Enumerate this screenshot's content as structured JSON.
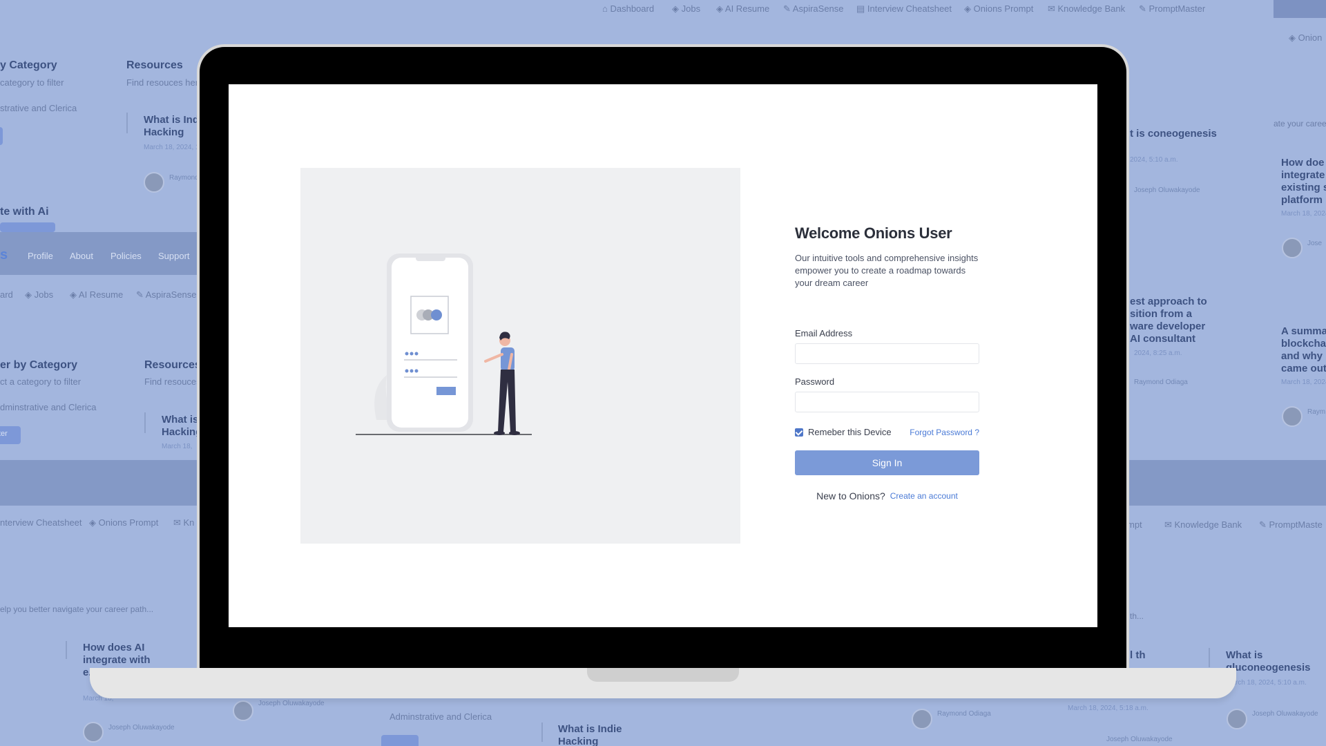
{
  "background": {
    "top_nav": [
      "Dashboard",
      "Jobs",
      "AI Resume",
      "AspiraSense",
      "Interview Cheatsheet",
      "Onions Prompt",
      "Knowledge Bank",
      "PromptMaster"
    ],
    "top_right_text": "Onion",
    "mid_nav": [
      "Profile",
      "About",
      "Policies",
      "Support"
    ],
    "mid_nav_logo": "s",
    "mid_nav2": [
      "ard",
      "Jobs",
      "AI Resume",
      "AspiraSense"
    ],
    "bottom_nav_left": [
      "nterview Cheatsheet",
      "Onions Prompt",
      "Kn"
    ],
    "bottom_nav_right": [
      "mpt",
      "Knowledge Bank",
      "PromptMaste"
    ],
    "category_title_1": "y Category",
    "category_sub_1": "category to filter",
    "category_item_1": "strative and Clerica",
    "resources_title_1": "Resources",
    "resources_sub_1": "Find resouces here",
    "article_1": "What is Ind Hacking",
    "article_1_date": "March 18, 2024, 1",
    "author_1": "Raymond",
    "ai_title": "te with Ai",
    "category_title_2": "er by Category",
    "category_sub_2": "ct a category to filter",
    "category_item_2": "dminstrative and Clerica",
    "resources_title_2": "Resources",
    "resources_sub_2": "Find resouces",
    "article_2": "What is Hacking",
    "article_2_date": "March 18,",
    "filter_btn": "ter",
    "career_text": "elp you better navigate your career path...",
    "article_3": "How does AI integrate with e... p...",
    "article_3_date": "March 18,",
    "author_3": "Joseph Oluwakayode",
    "author_3b": "Joseph Oluwakayode",
    "bottom_cat": "Adminstrative and Clerica",
    "article_4": "What is Indie Hacking",
    "right_article_1": "t is coneogenesis",
    "right_article_1_date": "2024, 5:10 a.m.",
    "right_author_1": "Joseph Oluwakayode",
    "right_article_2": "est approach to sition from a ware developer AI consultant",
    "right_article_2_date": "2024, 8:25 a.m.",
    "right_author_2": "Raymond Odiaga",
    "far_right_text": "ate your career",
    "far_right_article_1": "How doe integrate existing s platform",
    "far_right_date_1": "March 18, 2024",
    "far_right_author": "Jose",
    "far_right_article_2": "A summa blockcha and why came out",
    "far_right_date_2": "March 18, 2024",
    "far_right_author_2": "Raym",
    "right_bottom_article": "What is gluconeogenesis",
    "right_bottom_date": "March 18, 2024, 5:10 a.m.",
    "right_bottom_author": "Joseph Oluwakayode",
    "right_bottom_author2": "Raymond Odiaga",
    "right_bottom_date2": "March 18, 2024, 5:18 a.m.",
    "right_bottom_author3": "Joseph Oluwakayode",
    "right_mid_text": "th...",
    "right_article_3": "l th"
  },
  "login": {
    "title": "Welcome Onions User",
    "description": "Our intuitive tools and comprehensive insights empower you to create a roadmap towards your dream career",
    "email_label": "Email Address",
    "email_value": "",
    "password_label": "Password",
    "password_value": "",
    "remember_label": "Remeber this Device",
    "remember_checked": true,
    "forgot_link": "Forgot Password ?",
    "signin_button": "Sign In",
    "new_user_text": "New to Onions?",
    "create_account_link": "Create an account"
  },
  "colors": {
    "accent": "#7b9ad8",
    "link": "#4a7ad6",
    "background_overlay": "#a3b6de"
  },
  "icons": [
    "home-icon",
    "box-icon",
    "pencil-icon",
    "clipboard-icon",
    "mail-icon"
  ]
}
